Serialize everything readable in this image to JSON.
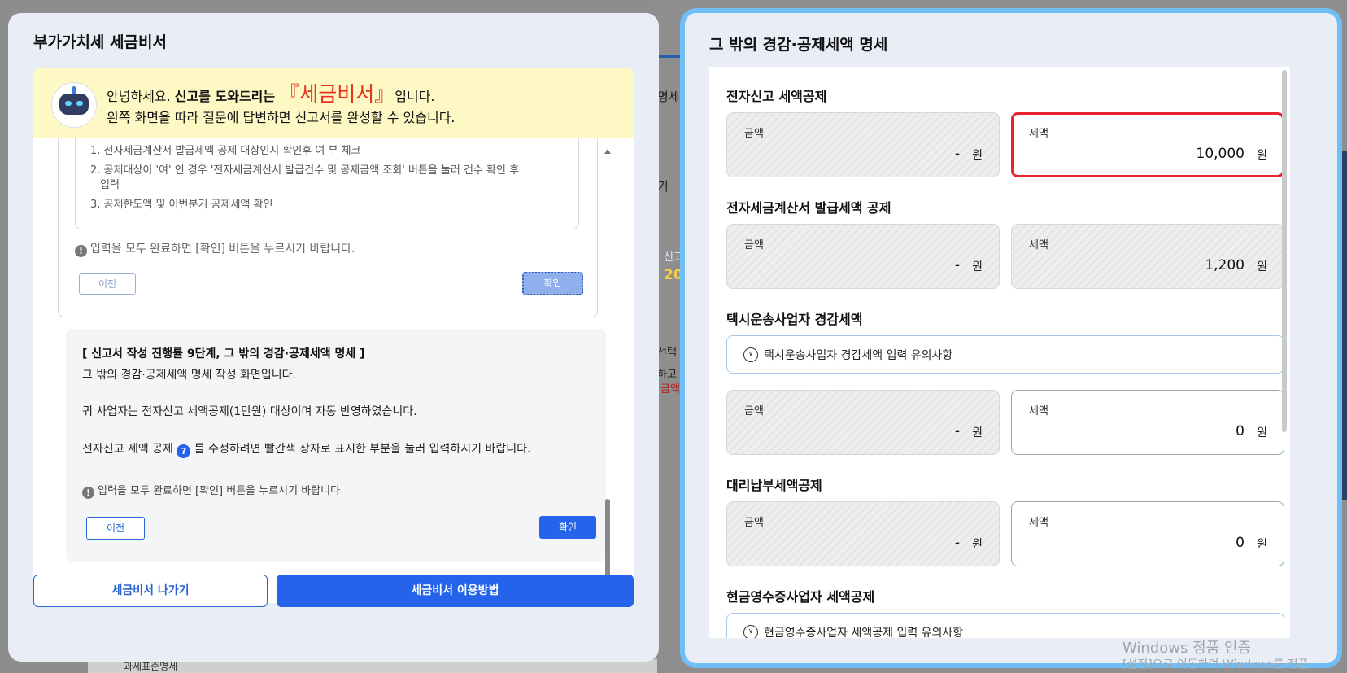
{
  "background": {
    "fragment_1": "명세·",
    "fragment_2": "기",
    "fragment_3": "신고",
    "fragment_4": "20",
    "fragment_5": "선택",
    "fragment_6": "하고",
    "fragment_7": "금액",
    "fragment_8": "과세표준명세"
  },
  "left": {
    "title": "부가가치세 세금비서",
    "intro": {
      "line1_prefix": "안녕하세요. ",
      "line1_bold": "신고를 도와드리는",
      "line1_brand": "『세금비서』",
      "line1_suffix": "입니다.",
      "line2": "왼쪽 화면을 따라 질문에 답변하면 신고서를 완성할 수 있습니다."
    },
    "faded": {
      "items": [
        "1. 전자세금계산서 발급세액 공제 대상인지 확인후 여 부 체크",
        "2. 공제대상이 '여' 인 경우 '전자세금계산서 발급건수 및 공제금액 조회' 버튼을 눌러 건수 확인 후",
        "입력",
        "3. 공제한도액 및 이번분기 공제세액 확인"
      ],
      "note": "입력을 모두 완료하면 [확인] 버튼을 누르시기 바랍니다.",
      "prev": "이전",
      "ok": "확인"
    },
    "step": {
      "title": "[ 신고서 작성 진행률 9단계, 그 밖의 경감·공제세액 명세 ]",
      "p1": "그 밖의 경감·공제세액 명세 작성 화면입니다.",
      "p2": "귀 사업자는 전자신고 세액공제(1만원) 대상이며 자동 반영하였습니다.",
      "p3_prefix": "전자신고 세액 공제 ",
      "p3_icon": "?",
      "p3_suffix": " 를 수정하려면 빨간색 상자로 표시한 부분을 눌러 입력하시기 바랍니다.",
      "note": "입력을 모두 완료하면 [확인] 버튼을 누르시기 바랍니다",
      "prev": "이전",
      "ok": "확인"
    },
    "exit_button": "세금비서 나가기",
    "howto_button": "세금비서 이용방법",
    "note_icon": "!"
  },
  "right": {
    "title": "그 밖의 경감·공제세액 명세",
    "sections": [
      {
        "title": "전자신고 세액공제",
        "amount_label": "금액",
        "amount_value": "-",
        "amount_unit": "원",
        "tax_label": "세액",
        "tax_value": "10,000",
        "tax_unit": "원"
      },
      {
        "title": "전자세금계산서 발급세액 공제",
        "amount_label": "금액",
        "amount_value": "-",
        "amount_unit": "원",
        "tax_label": "세액",
        "tax_value": "1,200",
        "tax_unit": "원"
      },
      {
        "title": "택시운송사업자 경감세액",
        "accordion": "택시운송사업자 경감세액 입력 유의사항",
        "amount_label": "금액",
        "amount_value": "-",
        "amount_unit": "원",
        "tax_label": "세액",
        "tax_value": "0",
        "tax_unit": "원"
      },
      {
        "title": "대리납부세액공제",
        "amount_label": "금액",
        "amount_value": "-",
        "amount_unit": "원",
        "tax_label": "세액",
        "tax_value": "0",
        "tax_unit": "원"
      },
      {
        "title": "현금영수증사업자 세액공제",
        "accordion": "현금영수증사업자 세액공제 입력 유의사항"
      }
    ]
  },
  "watermark": {
    "line1": "Windows 정품 인증",
    "line2": "[설정]으로 이동하여 Windows를 정품"
  },
  "colors": {
    "accent": "#2563eb",
    "highlight_border": "#e8232e",
    "brand_red": "#e8321e",
    "right_panel_border": "#6fbef5",
    "intro_bg": "#fdf8c4"
  },
  "icons": [
    "robot-mascot-icon",
    "info-circle-icon",
    "question-icon",
    "chevron-down-circle-icon"
  ]
}
